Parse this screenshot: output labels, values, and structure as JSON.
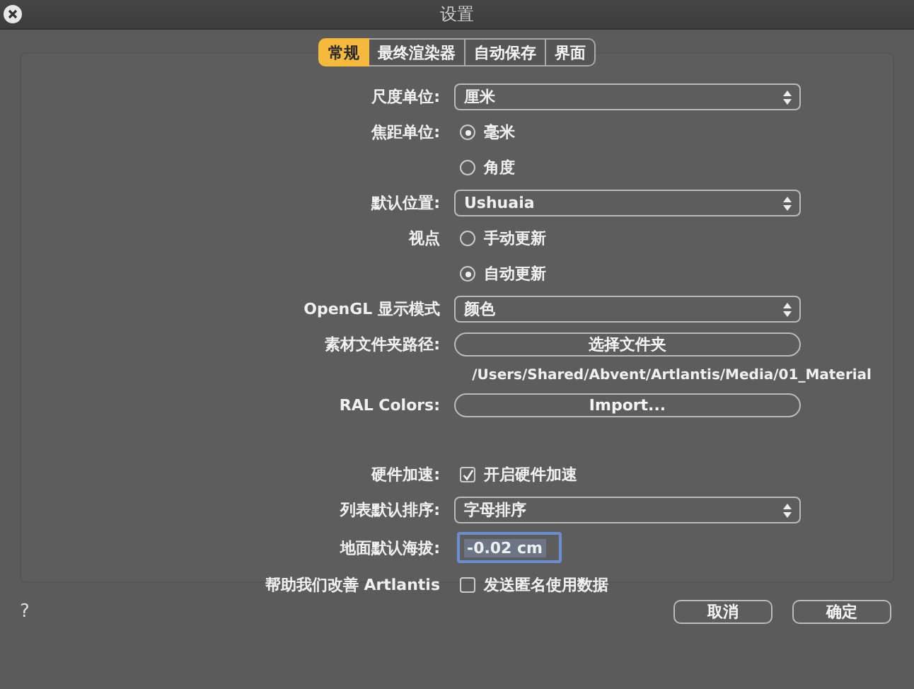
{
  "window": {
    "title": "设置"
  },
  "tabs": [
    {
      "label": "常规",
      "selected": true
    },
    {
      "label": "最终渲染器",
      "selected": false
    },
    {
      "label": "自动保存",
      "selected": false
    },
    {
      "label": "界面",
      "selected": false
    }
  ],
  "sections": [
    {
      "rows": [
        {
          "kind": "select",
          "label": "尺度单位:",
          "value": "厘米"
        },
        {
          "kind": "radio",
          "label": "焦距单位:",
          "options": [
            {
              "label": "毫米",
              "selected": true
            },
            {
              "label": "角度",
              "selected": false
            }
          ]
        },
        {
          "kind": "select",
          "label": "默认位置:",
          "value": "Ushuaia"
        },
        {
          "kind": "radio",
          "label": "视点",
          "options": [
            {
              "label": "手动更新",
              "selected": false
            },
            {
              "label": "自动更新",
              "selected": true
            }
          ]
        },
        {
          "kind": "select",
          "label": "OpenGL 显示模式",
          "value": "颜色"
        },
        {
          "kind": "button",
          "label": "素材文件夹路径:",
          "button": "选择文件夹"
        },
        {
          "kind": "path",
          "text": "/Users/Shared/Abvent/Artlantis/Media/01_Material"
        },
        {
          "kind": "button",
          "label": "RAL Colors:",
          "button": "Import..."
        }
      ]
    },
    {
      "rows": [
        {
          "kind": "checkbox",
          "label": "硬件加速:",
          "text": "开启硬件加速",
          "checked": true
        },
        {
          "kind": "select",
          "label": "列表默认排序:",
          "value": "字母排序"
        },
        {
          "kind": "input",
          "label": "地面默认海拔:",
          "value": "-0.02 cm"
        },
        {
          "kind": "checkbox",
          "label": "帮助我们改善 Artlantis",
          "text": "发送匿名使用数据",
          "checked": false
        }
      ]
    }
  ],
  "help": "?",
  "buttons": [
    "取消",
    "确定"
  ]
}
